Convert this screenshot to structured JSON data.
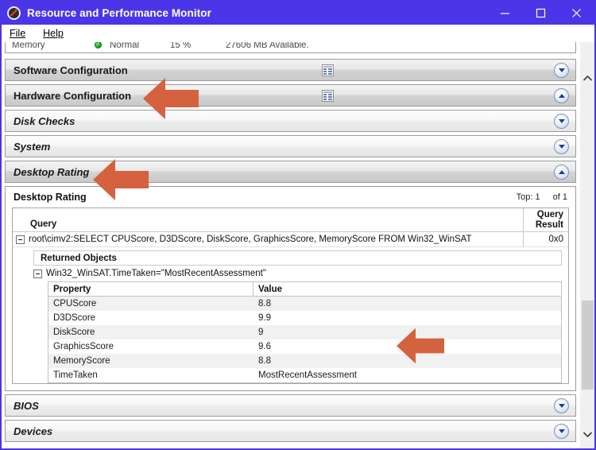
{
  "window": {
    "title": "Resource and Performance Monitor",
    "app_icon": "prohibition-circle-icon",
    "controls": {
      "minimize": "minimize-icon",
      "maximize": "maximize-icon",
      "close": "close-icon"
    }
  },
  "menu": {
    "items": [
      {
        "label": "File",
        "accel": "F"
      },
      {
        "label": "Help",
        "accel": "H"
      }
    ]
  },
  "clipped_row": {
    "name": "Memory",
    "status": "Normal",
    "percent": "15 %",
    "detail": "27606 MB Available."
  },
  "sections": [
    {
      "label": "Software Configuration",
      "italic": false,
      "expanded": false,
      "has_grid_icon": true
    },
    {
      "label": "Hardware Configuration",
      "italic": false,
      "expanded": true,
      "has_grid_icon": true
    },
    {
      "label": "Disk Checks",
      "italic": true,
      "expanded": false,
      "has_grid_icon": false
    },
    {
      "label": "System",
      "italic": true,
      "expanded": false,
      "has_grid_icon": false
    },
    {
      "label": "Desktop Rating",
      "italic": true,
      "expanded": true,
      "has_grid_icon": false
    },
    {
      "label": "BIOS",
      "italic": true,
      "expanded": false,
      "has_grid_icon": false
    },
    {
      "label": "Devices",
      "italic": true,
      "expanded": false,
      "has_grid_icon": false
    }
  ],
  "desktop_rating_panel": {
    "title": "Desktop Rating",
    "top_label": "Top:",
    "top_value": "1",
    "of_label": "of",
    "of_value": "1",
    "columns": {
      "query": "Query",
      "query_result_line1": "Query",
      "query_result_line2": "Result"
    },
    "query_row": {
      "text": "root\\cimv2:SELECT CPUScore, D3DScore, DiskScore, GraphicsScore, MemoryScore FROM Win32_WinSAT",
      "result": "0x0"
    },
    "returned_objects_label": "Returned Objects",
    "object_label": "Win32_WinSAT.TimeTaken=\"MostRecentAssessment\"",
    "property_columns": [
      "Property",
      "Value"
    ],
    "properties": [
      {
        "property": "CPUScore",
        "value": "8.8"
      },
      {
        "property": "D3DScore",
        "value": "9.9"
      },
      {
        "property": "DiskScore",
        "value": "9"
      },
      {
        "property": "GraphicsScore",
        "value": "9.6"
      },
      {
        "property": "MemoryScore",
        "value": "8.8"
      },
      {
        "property": "TimeTaken",
        "value": "MostRecentAssessment"
      }
    ]
  },
  "scrollbar": {
    "up_arrow": "chevron-up-icon",
    "down_arrow": "chevron-down-icon",
    "thumb": "scrollbar-thumb"
  },
  "annotations": {
    "arrow_color": "#d4623f",
    "arrows": [
      {
        "target": "Hardware Configuration"
      },
      {
        "target": "Desktop Rating"
      },
      {
        "target": "GraphicsScore row"
      }
    ]
  },
  "colors": {
    "titlebar": "#4b35e8",
    "accent_arrow": "#d4623f",
    "status_ok": "#0a9b17"
  }
}
